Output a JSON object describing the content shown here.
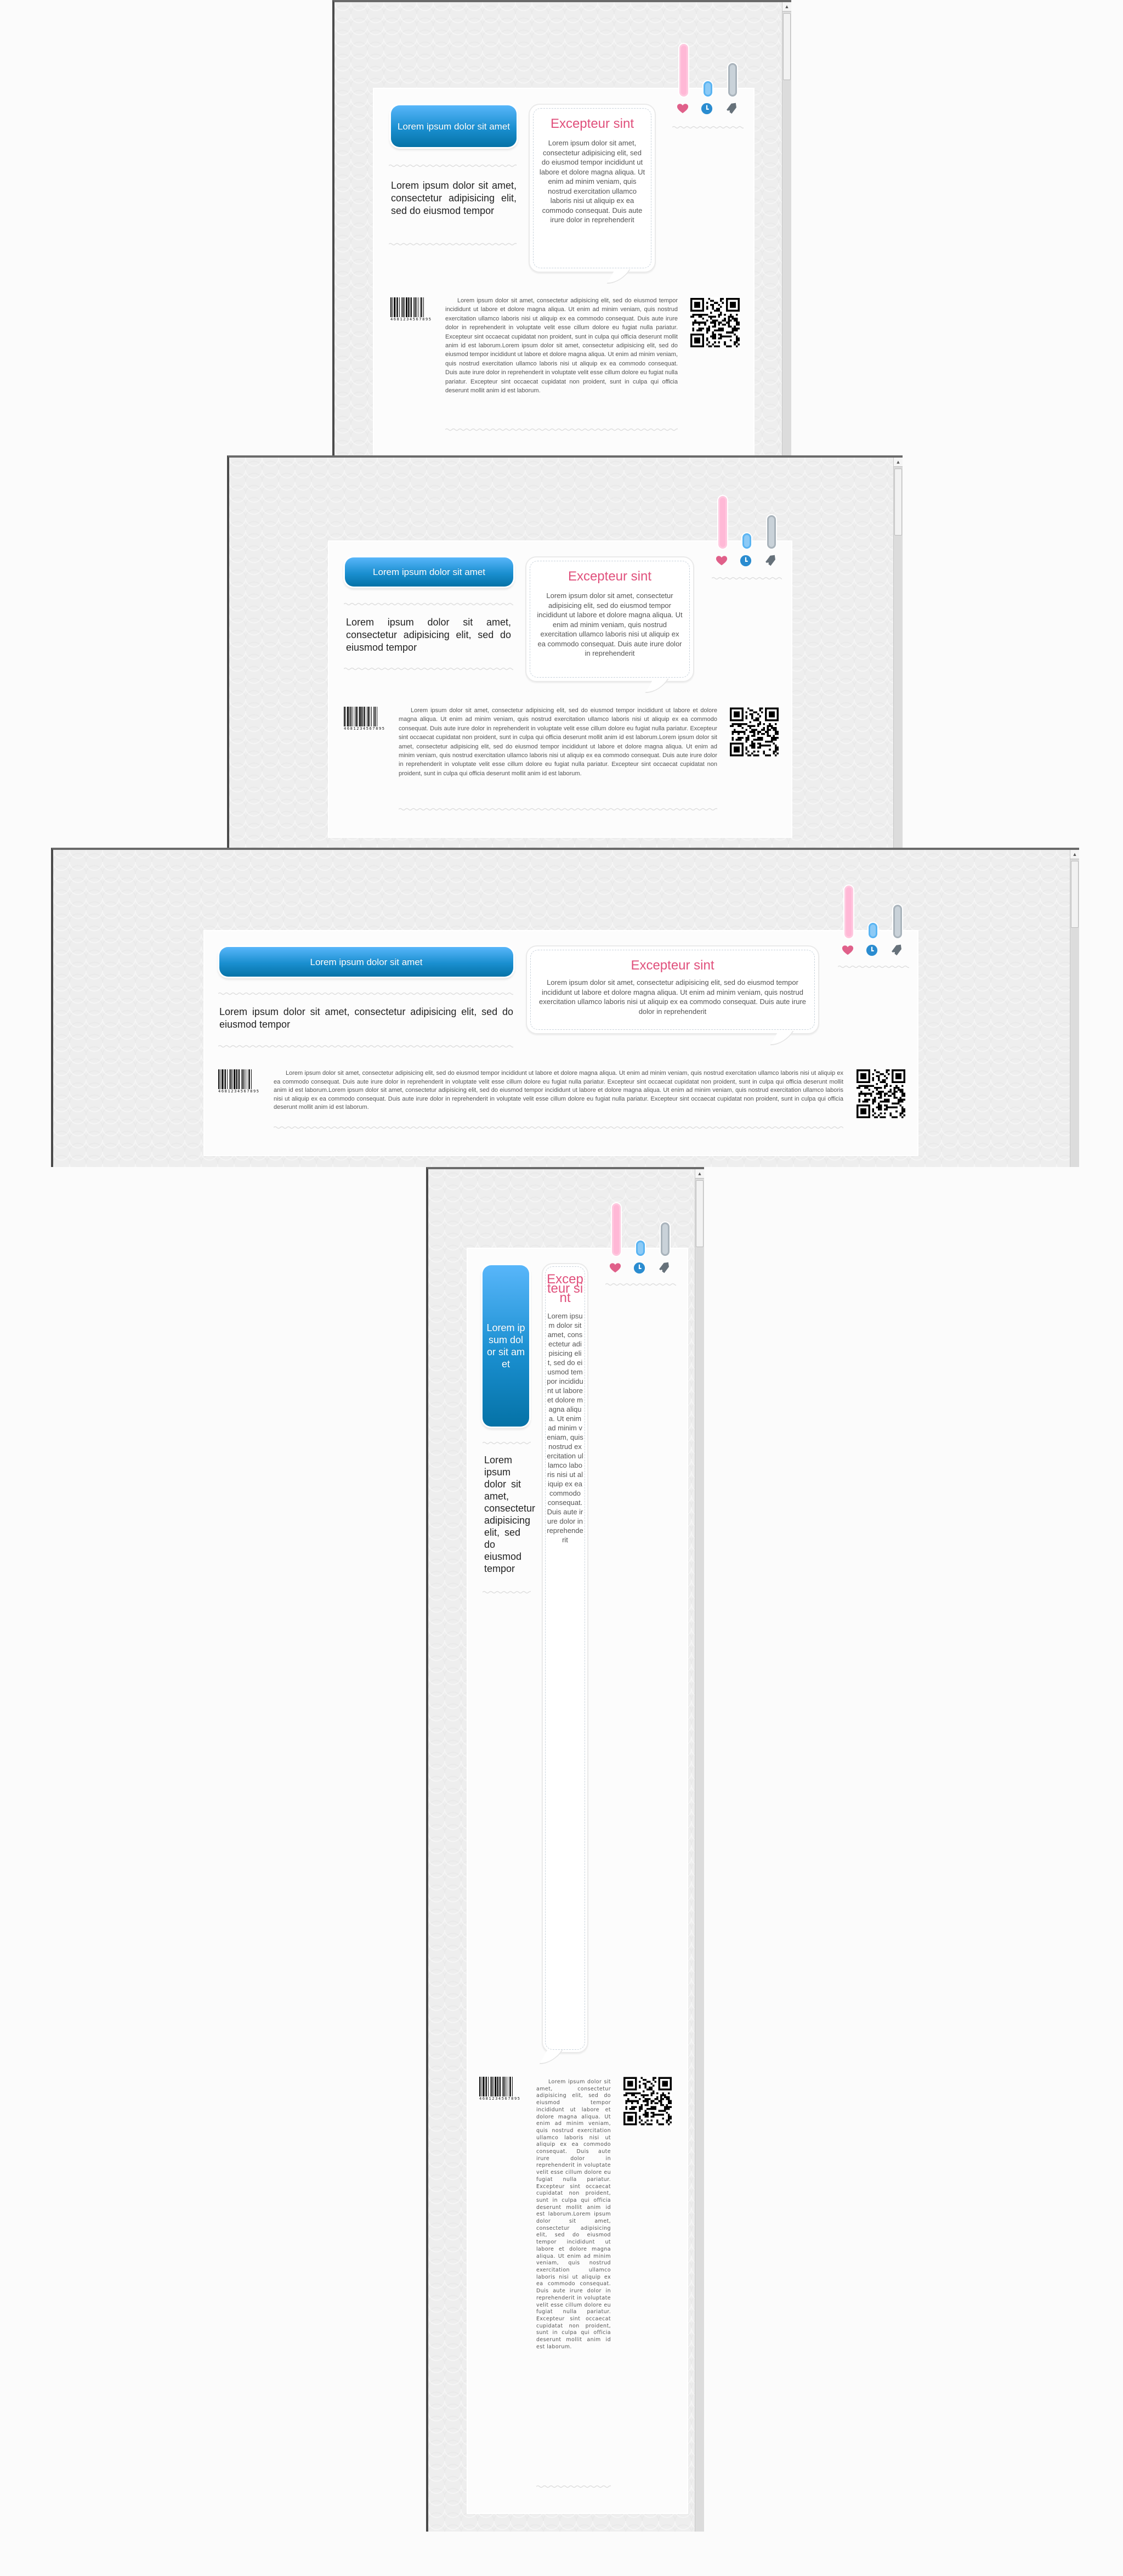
{
  "button_label": "Lorem ipsum dolor sit amet",
  "intro_text": "Lorem ipsum dolor sit amet, consectetur adipisicing elit, sed do eiusmod tempor",
  "bubble": {
    "title": "Excepteur sint",
    "text": "Lorem ipsum dolor sit amet, consectetur adipisicing elit, sed do eiusmod tempor incididunt ut labore et dolore magna aliqua. Ut enim ad minim veniam, quis nostrud exercitation ullamco laboris nisi ut aliquip ex ea commodo consequat. Duis aute irure dolor in reprehenderit"
  },
  "body_text": "Lorem ipsum dolor sit amet, consectetur adipisicing elit, sed do eiusmod tempor incididunt ut labore et dolore magna aliqua. Ut enim ad minim veniam, quis nostrud exercitation ullamco laboris nisi ut aliquip ex ea commodo consequat. Duis aute irure dolor in reprehenderit in voluptate velit esse cillum dolore eu fugiat nulla pariatur. Excepteur sint occaecat cupidatat non proident, sunt in culpa qui officia deserunt mollit anim id est laborum.Lorem ipsum dolor sit amet, consectetur adipisicing elit, sed do eiusmod tempor incididunt ut labore et dolore magna aliqua. Ut enim ad minim veniam, quis nostrud exercitation ullamco laboris nisi ut aliquip ex ea commodo consequat. Duis aute irure dolor in reprehenderit in voluptate velit esse cillum dolore eu fugiat nulla pariatur. Excepteur sint occaecat cupidatat non proident, sunt in culpa qui officia deserunt mollit anim id est laborum.",
  "barcode_number": "4681234567895",
  "icons": [
    {
      "name": "heart-icon",
      "color": "#e0608a",
      "bar_color": "#ffb8d6",
      "bar_border": "#ffc8df"
    },
    {
      "name": "clock-icon",
      "color": "#2a8cd0",
      "bar_color": "#8ccaf6",
      "bar_border": "#5ab4f2"
    },
    {
      "name": "tag-icon",
      "color": "#66717a",
      "bar_color": "#c9d2d9",
      "bar_border": "#a9b3bb"
    }
  ],
  "colors": {
    "accent_blue": "#1a8fd0",
    "title_pink": "#e0507c",
    "background": "#eeeeee"
  }
}
